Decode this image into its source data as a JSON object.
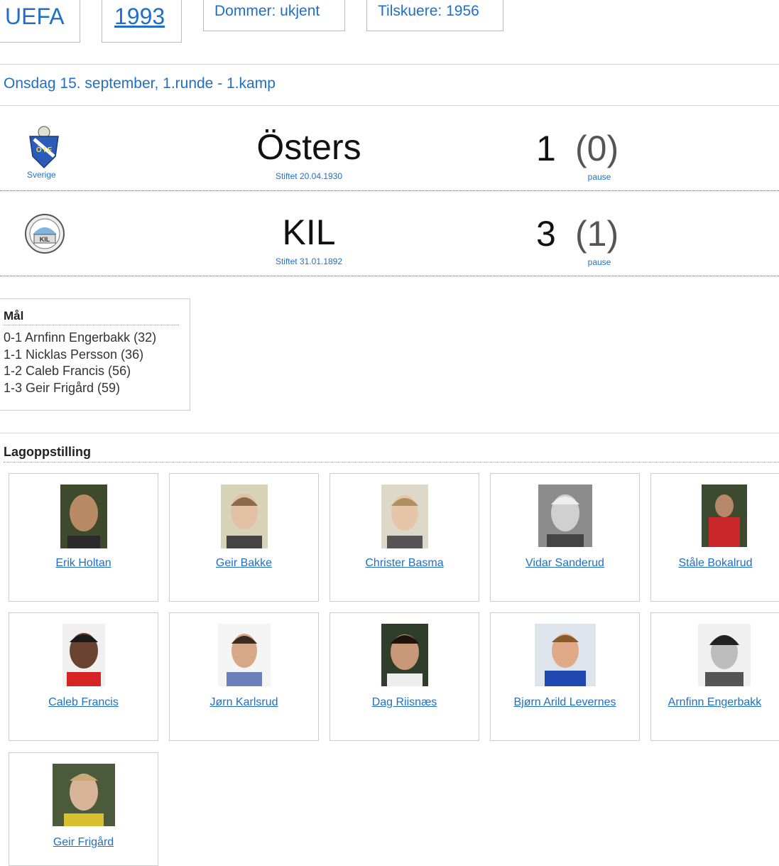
{
  "header": {
    "competition": "UEFA",
    "season": "1993",
    "referee": "Dommer: ukjent",
    "attendance": "Tilskuere: 1956"
  },
  "match": {
    "date_round": "Onsdag 15. september, 1.runde - 1.kamp",
    "home": {
      "country": "Sverige",
      "name": "Östers",
      "founded": "Stiftet 20.04.1930",
      "score": "1",
      "halftime": "(0)",
      "halftime_label": "pause",
      "logo_icon": "osters-crest-icon",
      "logo_text": "Ö I F"
    },
    "away": {
      "name": "KIL",
      "founded": "Stiftet 31.01.1892",
      "score": "3",
      "halftime": "(1)",
      "halftime_label": "pause",
      "logo_icon": "kil-crest-icon",
      "logo_text": "KIL"
    }
  },
  "goals": {
    "title": "Mål",
    "items": [
      "0-1 Arnfinn Engerbakk (32)",
      "1-1 Nicklas Persson (36)",
      "1-2 Caleb Francis (56)",
      "1-3 Geir Frigård (59)"
    ]
  },
  "lineup": {
    "title": "Lagoppstilling",
    "players": [
      {
        "name": "Erik Holtan"
      },
      {
        "name": "Geir Bakke"
      },
      {
        "name": "Christer Basma"
      },
      {
        "name": "Vidar Sanderud"
      },
      {
        "name": "Ståle Bokalrud"
      },
      {
        "name": "Caleb Francis"
      },
      {
        "name": "Jørn Karlsrud"
      },
      {
        "name": "Dag Riisnæs"
      },
      {
        "name": "Bjørn Arild Levernes"
      },
      {
        "name": "Arnfinn Engerbakk"
      },
      {
        "name": "Geir Frigård"
      }
    ]
  },
  "colors": {
    "link": "#1f6fc9",
    "text": "#222222",
    "border": "#cccccc"
  }
}
